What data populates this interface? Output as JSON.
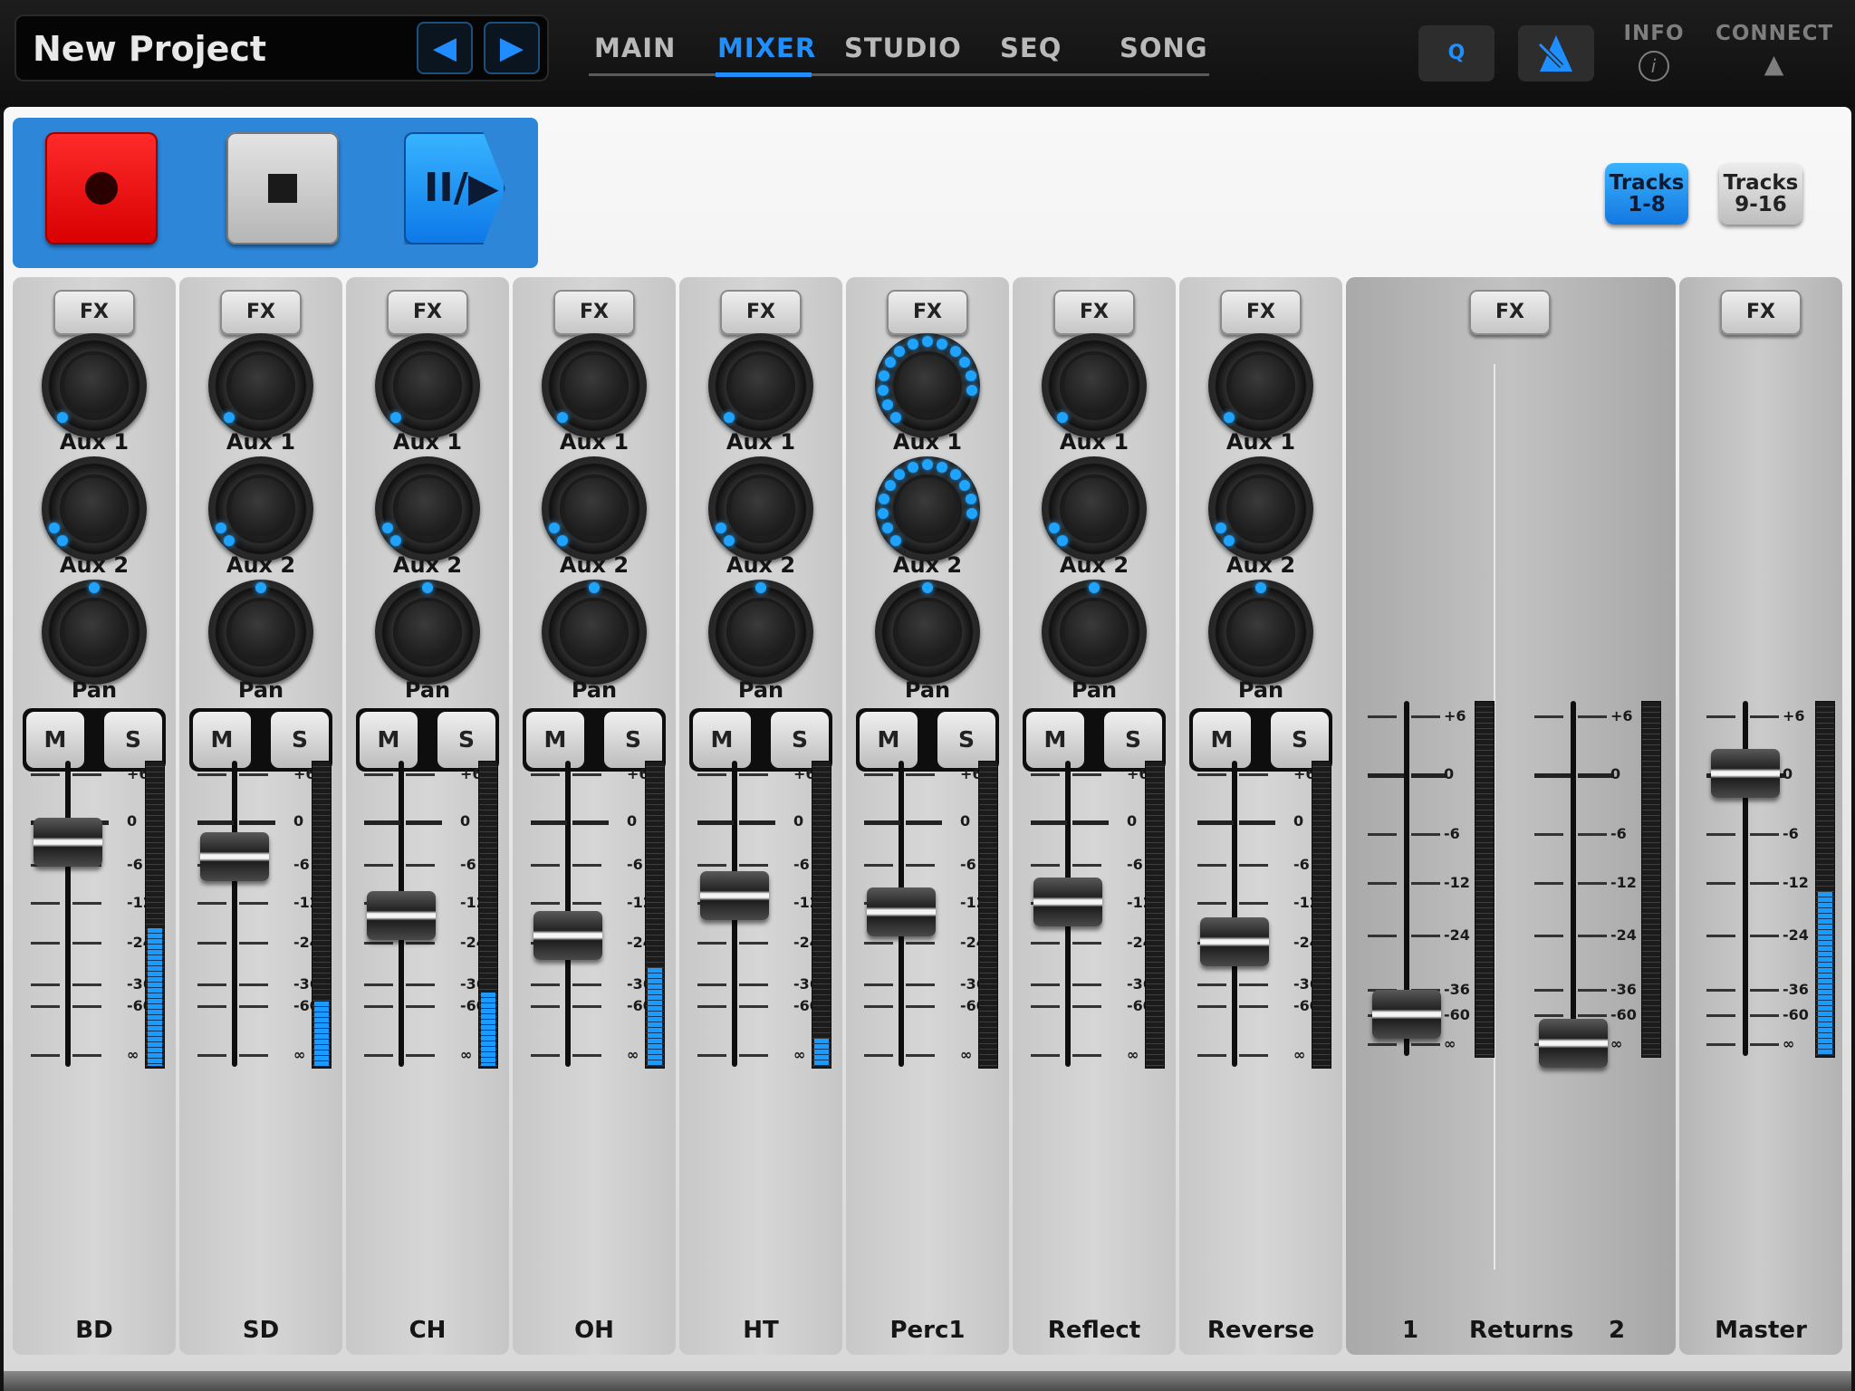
{
  "project": {
    "title": "New Project",
    "prev_icon": "◀",
    "next_icon": "▶"
  },
  "tabs": [
    {
      "label": "MAIN"
    },
    {
      "label": "MIXER"
    },
    {
      "label": "STUDIO"
    },
    {
      "label": "SEQ"
    },
    {
      "label": "SONG"
    }
  ],
  "active_tab": "MIXER",
  "top_right": {
    "quantize_label": "Q",
    "metronome_icon": "metronome-icon",
    "info_label": "INFO",
    "info_icon": "i",
    "connect_label": "CONNECT",
    "connect_icon": "▲"
  },
  "transport": {
    "record_icon": "record-icon",
    "stop_icon": "stop-icon",
    "play_pause_icon": "play-pause-icon",
    "play_glyph": "II/▶"
  },
  "track_groups": [
    {
      "line1": "Tracks",
      "line2": "1-8",
      "active": true
    },
    {
      "line1": "Tracks",
      "line2": "9-16",
      "active": false
    }
  ],
  "labels": {
    "fx": "FX",
    "aux1": "Aux 1",
    "aux2": "Aux 2",
    "pan": "Pan",
    "mute": "M",
    "solo": "S"
  },
  "scale_labels": [
    "+6",
    "0",
    "-6",
    "-12",
    "-24",
    "-36",
    "-60",
    "∞"
  ],
  "channels": [
    {
      "name": "BD",
      "aux1_level": 0.0,
      "aux2_level": 0.08,
      "pan": 0.5,
      "fader_db": -3,
      "meter_level": 0.45
    },
    {
      "name": "SD",
      "aux1_level": 0.0,
      "aux2_level": 0.08,
      "pan": 0.5,
      "fader_db": -5,
      "meter_level": 0.21
    },
    {
      "name": "CH",
      "aux1_level": 0.0,
      "aux2_level": 0.08,
      "pan": 0.5,
      "fader_db": -16,
      "meter_level": 0.24
    },
    {
      "name": "OH",
      "aux1_level": 0.0,
      "aux2_level": 0.08,
      "pan": 0.5,
      "fader_db": -22,
      "meter_level": 0.32
    },
    {
      "name": "HT",
      "aux1_level": 0.0,
      "aux2_level": 0.08,
      "pan": 0.5,
      "fader_db": -11,
      "meter_level": 0.09
    },
    {
      "name": "Perc1",
      "aux1_level": 0.85,
      "aux2_level": 0.85,
      "pan": 0.5,
      "fader_db": -15,
      "meter_level": 0.0
    },
    {
      "name": "Reflect",
      "aux1_level": 0.0,
      "aux2_level": 0.08,
      "pan": 0.5,
      "fader_db": -12,
      "meter_level": 0.0
    },
    {
      "name": "Reverse",
      "aux1_level": 0.0,
      "aux2_level": 0.08,
      "pan": 0.5,
      "fader_db": -24,
      "meter_level": 0.0
    }
  ],
  "returns": {
    "label": "Returns",
    "left_name": "1",
    "right_name": "2",
    "fader1_db": -60,
    "fader2_db": "∞"
  },
  "master": {
    "name": "Master",
    "fader_db": 0,
    "meter_level": 0.46
  },
  "colors": {
    "accent": "#1f8fff",
    "record": "#ff1a1a",
    "led": "#1fa3ff"
  }
}
